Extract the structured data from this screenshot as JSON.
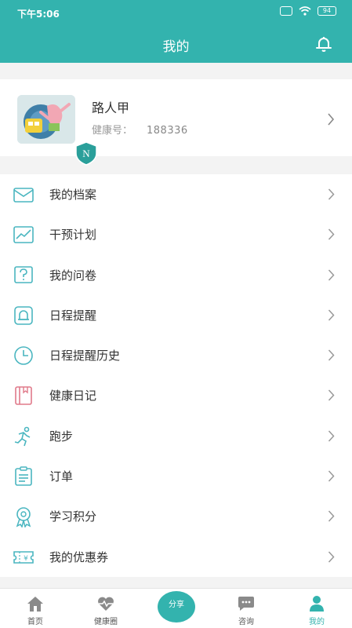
{
  "status": {
    "time": "下午5:06",
    "battery": "94"
  },
  "header": {
    "title": "我的",
    "bell_icon": "bell-icon"
  },
  "profile": {
    "name": "路人甲",
    "health_label": "健康号：",
    "health_number": "188336"
  },
  "menu": [
    {
      "label": "我的档案",
      "icon": "envelope-icon"
    },
    {
      "label": "干预计划",
      "icon": "trend-chart-icon"
    },
    {
      "label": "我的问卷",
      "icon": "question-icon"
    },
    {
      "label": "日程提醒",
      "icon": "bell-icon"
    },
    {
      "label": "日程提醒历史",
      "icon": "clock-icon"
    },
    {
      "label": "健康日记",
      "icon": "book-icon"
    },
    {
      "label": "跑步",
      "icon": "runner-icon"
    },
    {
      "label": "订单",
      "icon": "order-list-icon"
    },
    {
      "label": "学习积分",
      "icon": "medal-icon"
    },
    {
      "label": "我的优惠券",
      "icon": "coupon-icon"
    }
  ],
  "tabs": [
    {
      "label": "首页",
      "icon": "home-icon"
    },
    {
      "label": "健康圈",
      "icon": "heart-pulse-icon"
    },
    {
      "label": "咨询",
      "icon": "chat-icon"
    },
    {
      "label": "我的",
      "icon": "person-icon"
    }
  ],
  "center_button": {
    "label": "分享"
  },
  "colors": {
    "accent": "#33b3ae",
    "icon_teal": "#4ab6c0",
    "icon_pink": "#e07a8a",
    "icon_gray": "#8a8a8a"
  }
}
